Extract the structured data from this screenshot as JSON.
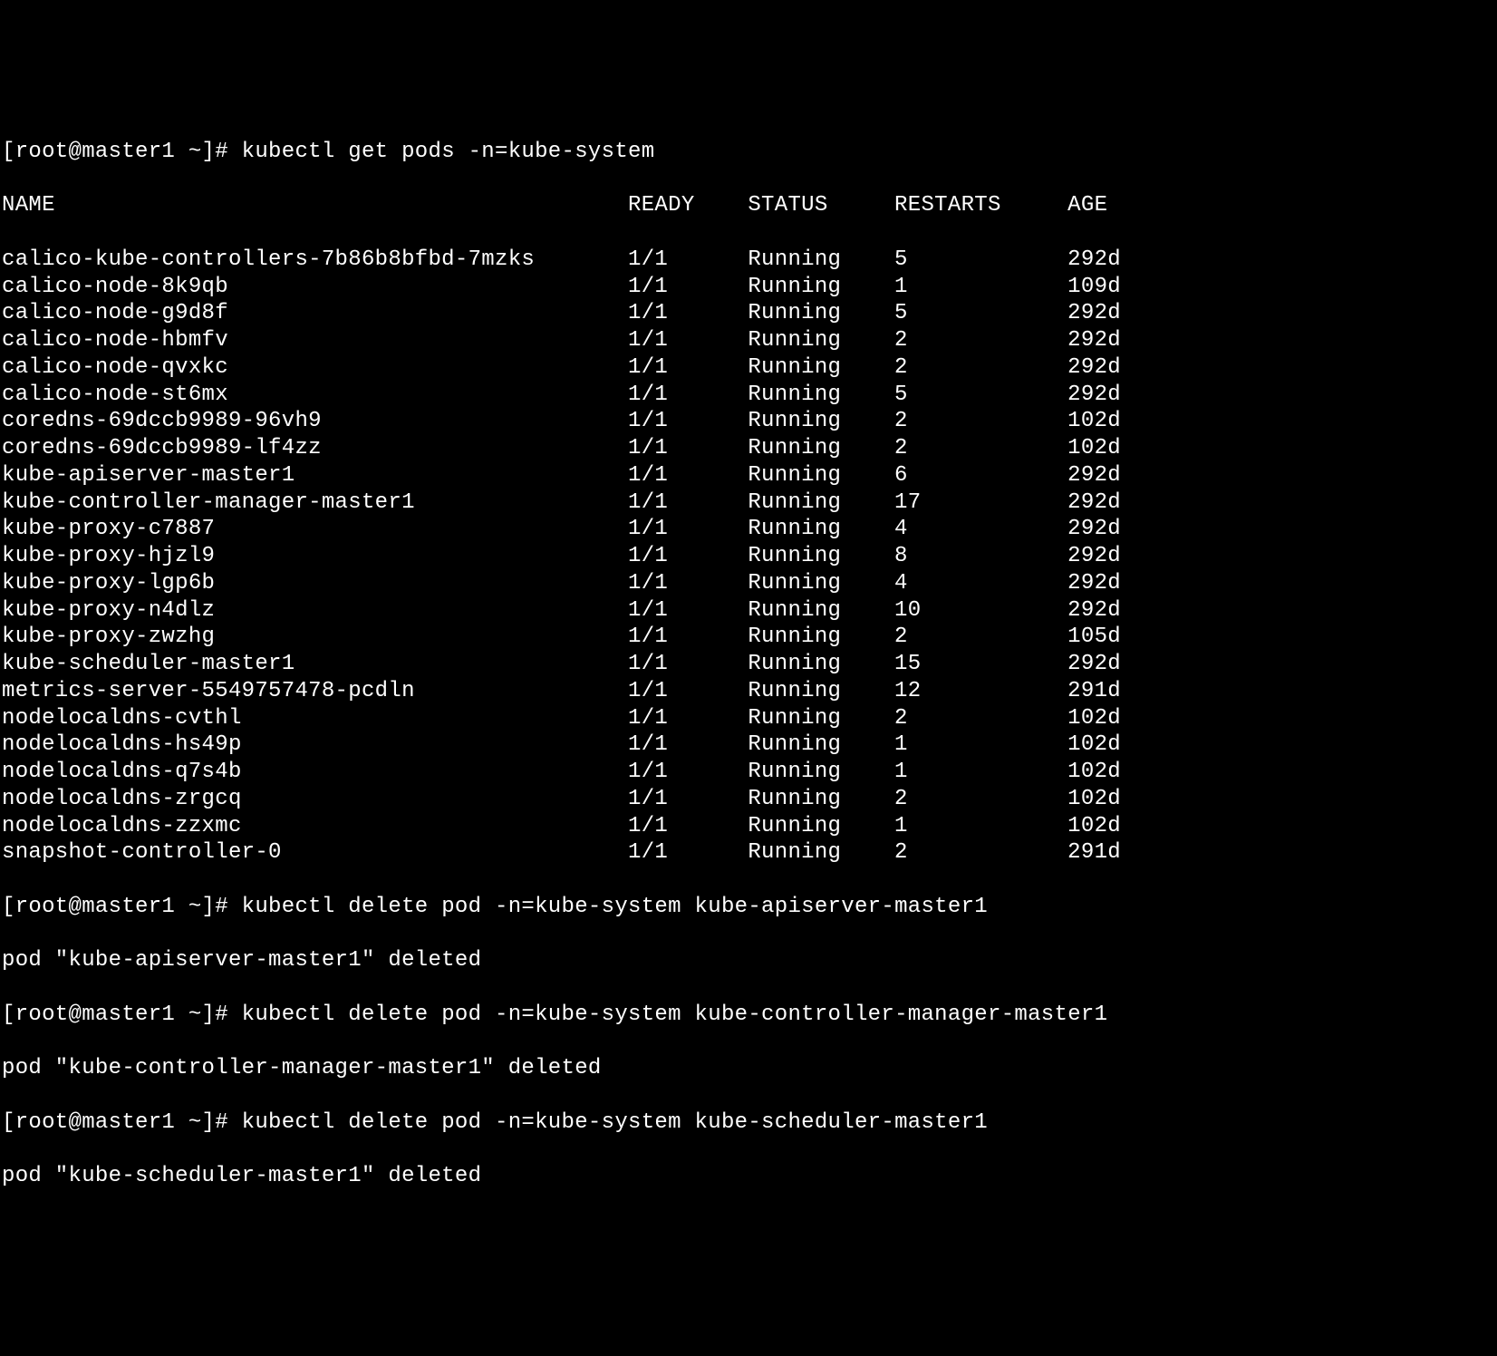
{
  "prompt": "[root@master1 ~]# ",
  "commands": {
    "get_pods": "kubectl get pods -n=kube-system",
    "delete_apiserver": "kubectl delete pod -n=kube-system kube-apiserver-master1",
    "delete_controller": "kubectl delete pod -n=kube-system kube-controller-manager-master1",
    "delete_scheduler": "kubectl delete pod -n=kube-system kube-scheduler-master1"
  },
  "headers": {
    "name": "NAME",
    "ready": "READY",
    "status": "STATUS",
    "restarts": "RESTARTS",
    "age": "AGE"
  },
  "pods": [
    {
      "name": "calico-kube-controllers-7b86b8bfbd-7mzks",
      "ready": "1/1",
      "status": "Running",
      "restarts": "5",
      "age": "292d"
    },
    {
      "name": "calico-node-8k9qb",
      "ready": "1/1",
      "status": "Running",
      "restarts": "1",
      "age": "109d"
    },
    {
      "name": "calico-node-g9d8f",
      "ready": "1/1",
      "status": "Running",
      "restarts": "5",
      "age": "292d"
    },
    {
      "name": "calico-node-hbmfv",
      "ready": "1/1",
      "status": "Running",
      "restarts": "2",
      "age": "292d"
    },
    {
      "name": "calico-node-qvxkc",
      "ready": "1/1",
      "status": "Running",
      "restarts": "2",
      "age": "292d"
    },
    {
      "name": "calico-node-st6mx",
      "ready": "1/1",
      "status": "Running",
      "restarts": "5",
      "age": "292d"
    },
    {
      "name": "coredns-69dccb9989-96vh9",
      "ready": "1/1",
      "status": "Running",
      "restarts": "2",
      "age": "102d"
    },
    {
      "name": "coredns-69dccb9989-lf4zz",
      "ready": "1/1",
      "status": "Running",
      "restarts": "2",
      "age": "102d"
    },
    {
      "name": "kube-apiserver-master1",
      "ready": "1/1",
      "status": "Running",
      "restarts": "6",
      "age": "292d"
    },
    {
      "name": "kube-controller-manager-master1",
      "ready": "1/1",
      "status": "Running",
      "restarts": "17",
      "age": "292d"
    },
    {
      "name": "kube-proxy-c7887",
      "ready": "1/1",
      "status": "Running",
      "restarts": "4",
      "age": "292d"
    },
    {
      "name": "kube-proxy-hjzl9",
      "ready": "1/1",
      "status": "Running",
      "restarts": "8",
      "age": "292d"
    },
    {
      "name": "kube-proxy-lgp6b",
      "ready": "1/1",
      "status": "Running",
      "restarts": "4",
      "age": "292d"
    },
    {
      "name": "kube-proxy-n4dlz",
      "ready": "1/1",
      "status": "Running",
      "restarts": "10",
      "age": "292d"
    },
    {
      "name": "kube-proxy-zwzhg",
      "ready": "1/1",
      "status": "Running",
      "restarts": "2",
      "age": "105d"
    },
    {
      "name": "kube-scheduler-master1",
      "ready": "1/1",
      "status": "Running",
      "restarts": "15",
      "age": "292d"
    },
    {
      "name": "metrics-server-5549757478-pcdln",
      "ready": "1/1",
      "status": "Running",
      "restarts": "12",
      "age": "291d"
    },
    {
      "name": "nodelocaldns-cvthl",
      "ready": "1/1",
      "status": "Running",
      "restarts": "2",
      "age": "102d"
    },
    {
      "name": "nodelocaldns-hs49p",
      "ready": "1/1",
      "status": "Running",
      "restarts": "1",
      "age": "102d"
    },
    {
      "name": "nodelocaldns-q7s4b",
      "ready": "1/1",
      "status": "Running",
      "restarts": "1",
      "age": "102d"
    },
    {
      "name": "nodelocaldns-zrgcq",
      "ready": "1/1",
      "status": "Running",
      "restarts": "2",
      "age": "102d"
    },
    {
      "name": "nodelocaldns-zzxmc",
      "ready": "1/1",
      "status": "Running",
      "restarts": "1",
      "age": "102d"
    },
    {
      "name": "snapshot-controller-0",
      "ready": "1/1",
      "status": "Running",
      "restarts": "2",
      "age": "291d"
    }
  ],
  "outputs": {
    "deleted_apiserver": "pod \"kube-apiserver-master1\" deleted",
    "deleted_controller": "pod \"kube-controller-manager-master1\" deleted",
    "deleted_scheduler": "pod \"kube-scheduler-master1\" deleted"
  },
  "column_widths": {
    "name": 47,
    "ready": 9,
    "status": 11,
    "restarts": 13
  }
}
